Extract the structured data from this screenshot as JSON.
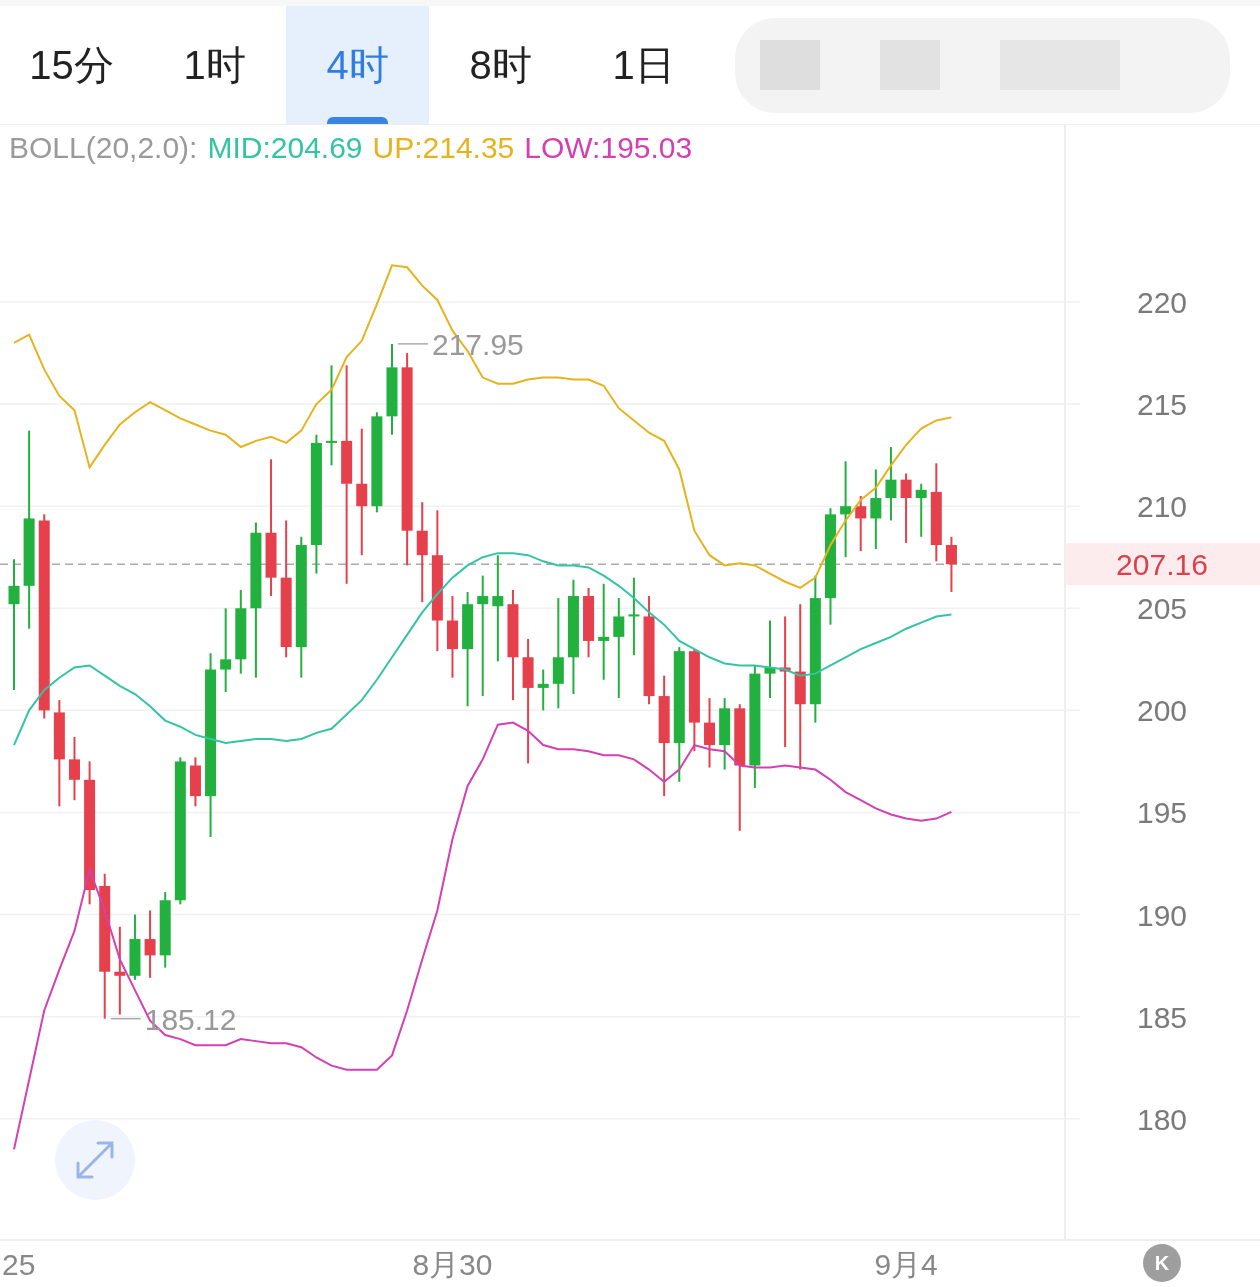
{
  "tabs": [
    {
      "label": "15分",
      "selected": false
    },
    {
      "label": "1时",
      "selected": false
    },
    {
      "label": "4时",
      "selected": true
    },
    {
      "label": "8时",
      "selected": false
    },
    {
      "label": "1日",
      "selected": false
    }
  ],
  "indicator": {
    "label": "BOLL(20,2.0):",
    "items": [
      {
        "text": "MID:204.69",
        "color": "#34c4a4"
      },
      {
        "text": "UP:214.35",
        "color": "#e6b31e"
      },
      {
        "text": "LOW:195.03",
        "color": "#d43fb2"
      }
    ]
  },
  "chart_data": {
    "type": "candlestick",
    "ylim": [
      174.06,
      228.67
    ],
    "grid": true,
    "categories": [
      "25",
      null,
      null,
      null,
      null,
      null,
      null,
      null,
      null,
      null,
      null,
      null,
      null,
      null,
      null,
      null,
      null,
      null,
      null,
      null,
      null,
      null,
      null,
      null,
      null,
      null,
      null,
      null,
      null,
      "8月30",
      null,
      null,
      null,
      null,
      null,
      null,
      null,
      null,
      null,
      null,
      null,
      null,
      null,
      null,
      null,
      null,
      null,
      null,
      null,
      null,
      null,
      null,
      null,
      null,
      null,
      null,
      null,
      null,
      null,
      "9月4",
      null,
      null,
      null
    ],
    "ref_lines": [
      {
        "axis": "y",
        "value": 207.16
      }
    ],
    "yticks": [
      180,
      185,
      190,
      195,
      200,
      205,
      210,
      215,
      220
    ],
    "series": [
      {
        "type": "line",
        "color": "#e6b31e",
        "values": [
          218.0,
          218.4,
          216.7,
          215.4,
          214.7,
          211.9,
          213.0,
          214.0,
          214.6,
          215.1,
          214.7,
          214.3,
          214.0,
          213.7,
          213.5,
          212.9,
          213.2,
          213.4,
          213.1,
          213.7,
          215.0,
          215.7,
          217.3,
          218.1,
          219.9,
          221.8,
          221.7,
          220.8,
          220.1,
          218.6,
          217.6,
          216.3,
          216.0,
          216.0,
          216.2,
          216.3,
          216.3,
          216.2,
          216.2,
          215.9,
          214.8,
          214.2,
          213.6,
          213.2,
          211.8,
          208.8,
          207.6,
          207.1,
          207.2,
          207.1,
          206.7,
          206.3,
          206.0,
          206.5,
          208.1,
          209.3,
          210.3,
          210.9,
          212.0,
          213.0,
          213.8,
          214.2,
          214.35
        ]
      },
      {
        "type": "line",
        "color": "#34c4a4",
        "values": [
          198.3,
          200.0,
          201.0,
          201.6,
          202.1,
          202.2,
          201.7,
          201.2,
          200.8,
          200.2,
          199.5,
          199.2,
          198.8,
          198.6,
          198.4,
          198.5,
          198.6,
          198.6,
          198.5,
          198.6,
          198.9,
          199.1,
          199.8,
          200.5,
          201.5,
          202.6,
          203.7,
          204.8,
          205.7,
          206.5,
          207.1,
          207.5,
          207.7,
          207.7,
          207.6,
          207.3,
          207.1,
          207.1,
          207.0,
          206.6,
          206.1,
          205.5,
          204.8,
          204.2,
          203.4,
          203.0,
          202.6,
          202.3,
          202.2,
          202.2,
          202.1,
          202.0,
          201.7,
          201.8,
          202.2,
          202.6,
          203.0,
          203.3,
          203.6,
          204.0,
          204.3,
          204.6,
          204.69
        ]
      },
      {
        "type": "line",
        "color": "#d43fb2",
        "values": [
          178.5,
          181.9,
          185.3,
          187.3,
          189.2,
          192.2,
          190.2,
          187.8,
          186.3,
          184.8,
          184.1,
          183.9,
          183.6,
          183.6,
          183.6,
          183.9,
          183.8,
          183.7,
          183.7,
          183.5,
          183.0,
          182.6,
          182.4,
          182.4,
          182.4,
          183.1,
          185.3,
          187.8,
          190.2,
          193.7,
          196.3,
          197.6,
          199.3,
          199.4,
          199.0,
          198.3,
          198.1,
          198.1,
          198.0,
          197.8,
          197.8,
          197.6,
          197.1,
          196.5,
          197.1,
          198.3,
          198.1,
          198.0,
          197.3,
          197.2,
          197.2,
          197.3,
          197.2,
          197.1,
          196.6,
          196.0,
          195.6,
          195.2,
          194.9,
          194.7,
          194.6,
          194.7,
          195.03
        ]
      }
    ],
    "ohlc": [
      [
        205.2,
        207.4,
        201,
        206.1
      ],
      [
        206.1,
        213.7,
        204,
        209.4
      ],
      [
        209.3,
        209.6,
        199.6,
        200
      ],
      [
        199.9,
        200.5,
        195.3,
        197.6
      ],
      [
        197.6,
        198.7,
        195.6,
        196.6
      ],
      [
        196.6,
        197.5,
        190.5,
        191.2
      ],
      [
        191.4,
        192,
        184.9,
        187.2
      ],
      [
        187.2,
        189.4,
        185.1,
        187
      ],
      [
        187,
        190,
        186.8,
        188.8
      ],
      [
        188.8,
        190.2,
        186.9,
        188
      ],
      [
        188,
        191.1,
        187.4,
        190.7
      ],
      [
        190.7,
        197.7,
        190.5,
        197.5
      ],
      [
        197.3,
        197.7,
        195.3,
        195.8
      ],
      [
        195.8,
        202.8,
        193.8,
        202
      ],
      [
        202,
        205,
        200.9,
        202.5
      ],
      [
        202.5,
        205.9,
        201.8,
        205
      ],
      [
        205,
        209.2,
        201.6,
        208.7
      ],
      [
        208.7,
        212.3,
        205.6,
        206.5
      ],
      [
        206.5,
        209.3,
        202.6,
        203.1
      ],
      [
        203.1,
        208.5,
        201.6,
        208.1
      ],
      [
        208.1,
        213.5,
        206.7,
        213.1
      ],
      [
        213.1,
        216.9,
        212,
        213.2
      ],
      [
        213.2,
        216.9,
        206.2,
        211.1
      ],
      [
        211.1,
        213.8,
        207.6,
        210
      ],
      [
        210,
        214.6,
        209.7,
        214.4
      ],
      [
        214.4,
        217.95,
        213.5,
        216.8
      ],
      [
        216.8,
        217.5,
        207.1,
        208.8
      ],
      [
        208.8,
        210.2,
        205.3,
        207.6
      ],
      [
        207.6,
        209.8,
        202.9,
        204.4
      ],
      [
        204.4,
        205.6,
        201.6,
        203
      ],
      [
        203,
        205.8,
        200.2,
        205.2
      ],
      [
        205.2,
        206.6,
        200.7,
        205.6
      ],
      [
        205.1,
        207.6,
        202.4,
        205.6
      ],
      [
        205.2,
        205.9,
        200.5,
        202.6
      ],
      [
        202.6,
        203.5,
        197.4,
        201.1
      ],
      [
        201.1,
        202,
        200,
        201.3
      ],
      [
        201.3,
        205.5,
        200.1,
        202.6
      ],
      [
        202.6,
        206.4,
        200.8,
        205.6
      ],
      [
        205.6,
        206,
        202.6,
        203.4
      ],
      [
        203.4,
        206.2,
        201.5,
        203.6
      ],
      [
        203.6,
        205.5,
        200.6,
        204.6
      ],
      [
        204.6,
        206.5,
        202.7,
        204.7
      ],
      [
        204.6,
        205.6,
        200.3,
        200.7
      ],
      [
        200.7,
        201.7,
        195.8,
        198.4
      ],
      [
        198.4,
        203.1,
        196.5,
        202.9
      ],
      [
        202.9,
        203,
        198,
        199.4
      ],
      [
        199.4,
        200.6,
        197.2,
        198.3
      ],
      [
        198.3,
        200.6,
        197.1,
        200.1
      ],
      [
        200.1,
        200.3,
        194.1,
        197.3
      ],
      [
        197.3,
        202.2,
        196.2,
        201.8
      ],
      [
        201.8,
        204.4,
        200.6,
        202.1
      ],
      [
        202.1,
        204.6,
        198.2,
        201.9
      ],
      [
        201.9,
        205.2,
        197.1,
        200.3
      ],
      [
        200.3,
        206.6,
        199.4,
        205.5
      ],
      [
        205.5,
        209.9,
        204.2,
        209.6
      ],
      [
        209.6,
        212.2,
        207.5,
        210
      ],
      [
        210,
        210.5,
        207.8,
        209.4
      ],
      [
        209.4,
        211.8,
        207.9,
        210.4
      ],
      [
        210.4,
        212.9,
        209.3,
        211.3
      ],
      [
        211.3,
        211.6,
        208.2,
        210.4
      ],
      [
        210.4,
        211.1,
        208.5,
        210.8
      ],
      [
        210.7,
        212.1,
        207.3,
        208.1
      ],
      [
        208.1,
        208.5,
        205.8,
        207.16
      ]
    ]
  },
  "high_label": "217.95",
  "low_label": "185.12",
  "current_price": "207.16",
  "corner_button": "K"
}
